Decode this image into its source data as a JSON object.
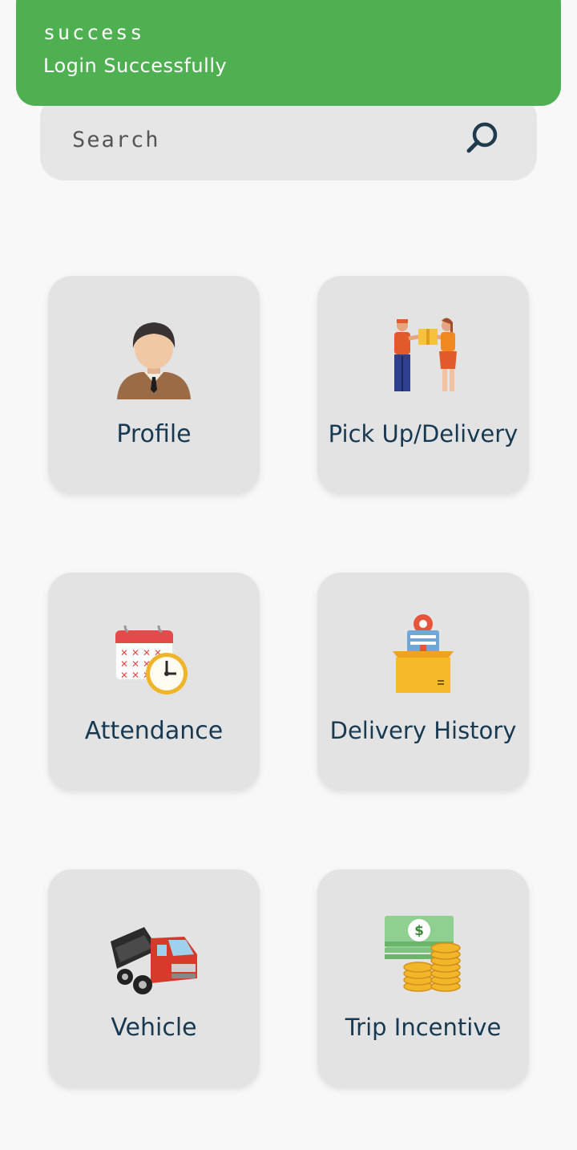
{
  "toast": {
    "title": "success",
    "message": "Login Successfully",
    "color": "#4fb052"
  },
  "search": {
    "placeholder": "Search",
    "icon": "search-icon"
  },
  "tiles": [
    {
      "label": "Profile",
      "icon": "profile-icon"
    },
    {
      "label": "Pick Up/Delivery",
      "icon": "delivery-handoff-icon"
    },
    {
      "label": "Attendance",
      "icon": "calendar-clock-icon"
    },
    {
      "label": "Delivery History",
      "icon": "package-history-icon"
    },
    {
      "label": "Vehicle",
      "icon": "truck-icon"
    },
    {
      "label": "Trip Incentive",
      "icon": "money-coins-icon"
    }
  ],
  "colors": {
    "background": "#f8f8f8",
    "tile": "#e3e3e3",
    "label": "#173a52"
  }
}
